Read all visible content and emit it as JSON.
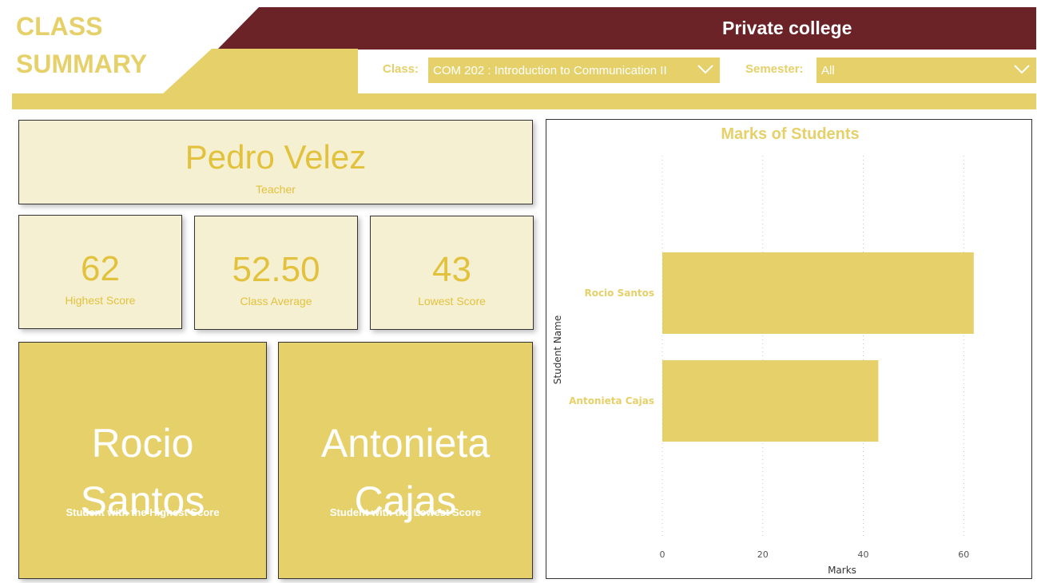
{
  "header": {
    "title_line1": "CLASS",
    "title_line2": "SUMMARY",
    "college_name": "Private college"
  },
  "filters": {
    "class_label": "Class:",
    "class_value": "COM 202 : Introduction to Communication II",
    "semester_label": "Semester:",
    "semester_value": "All"
  },
  "teacher": {
    "name": "Pedro Velez",
    "caption": "Teacher"
  },
  "kpis": {
    "highest_value": "62",
    "highest_label": "Highest Score",
    "average_value": "52.50",
    "average_label": "Class Average",
    "lowest_value": "43",
    "lowest_label": "Lowest Score"
  },
  "top_student": {
    "name_line1": "Rocio",
    "name_line2": "Santos",
    "caption": "Student with the Highest Score"
  },
  "bottom_student": {
    "name_line1": "Antonieta",
    "name_line2": "Cajas",
    "caption": "Student with the Lowest Score"
  },
  "colors": {
    "gold": "#e6d06a",
    "gold_text": "#e2c23c",
    "maroon": "#6b2328",
    "card_bg": "#f6f0d2"
  },
  "chart_data": {
    "type": "bar",
    "orientation": "horizontal",
    "title": "Marks of Students",
    "xlabel": "Marks",
    "ylabel": "Student Name",
    "categories": [
      "Rocio Santos",
      "Antonieta Cajas"
    ],
    "values": [
      62,
      43
    ],
    "xlim": [
      0,
      66
    ],
    "xticks": [
      "0",
      "20",
      "40",
      "60"
    ],
    "xtick_values": [
      0,
      20,
      40,
      60
    ],
    "grid": "vertical-dotted",
    "color": "#e6d06a"
  }
}
